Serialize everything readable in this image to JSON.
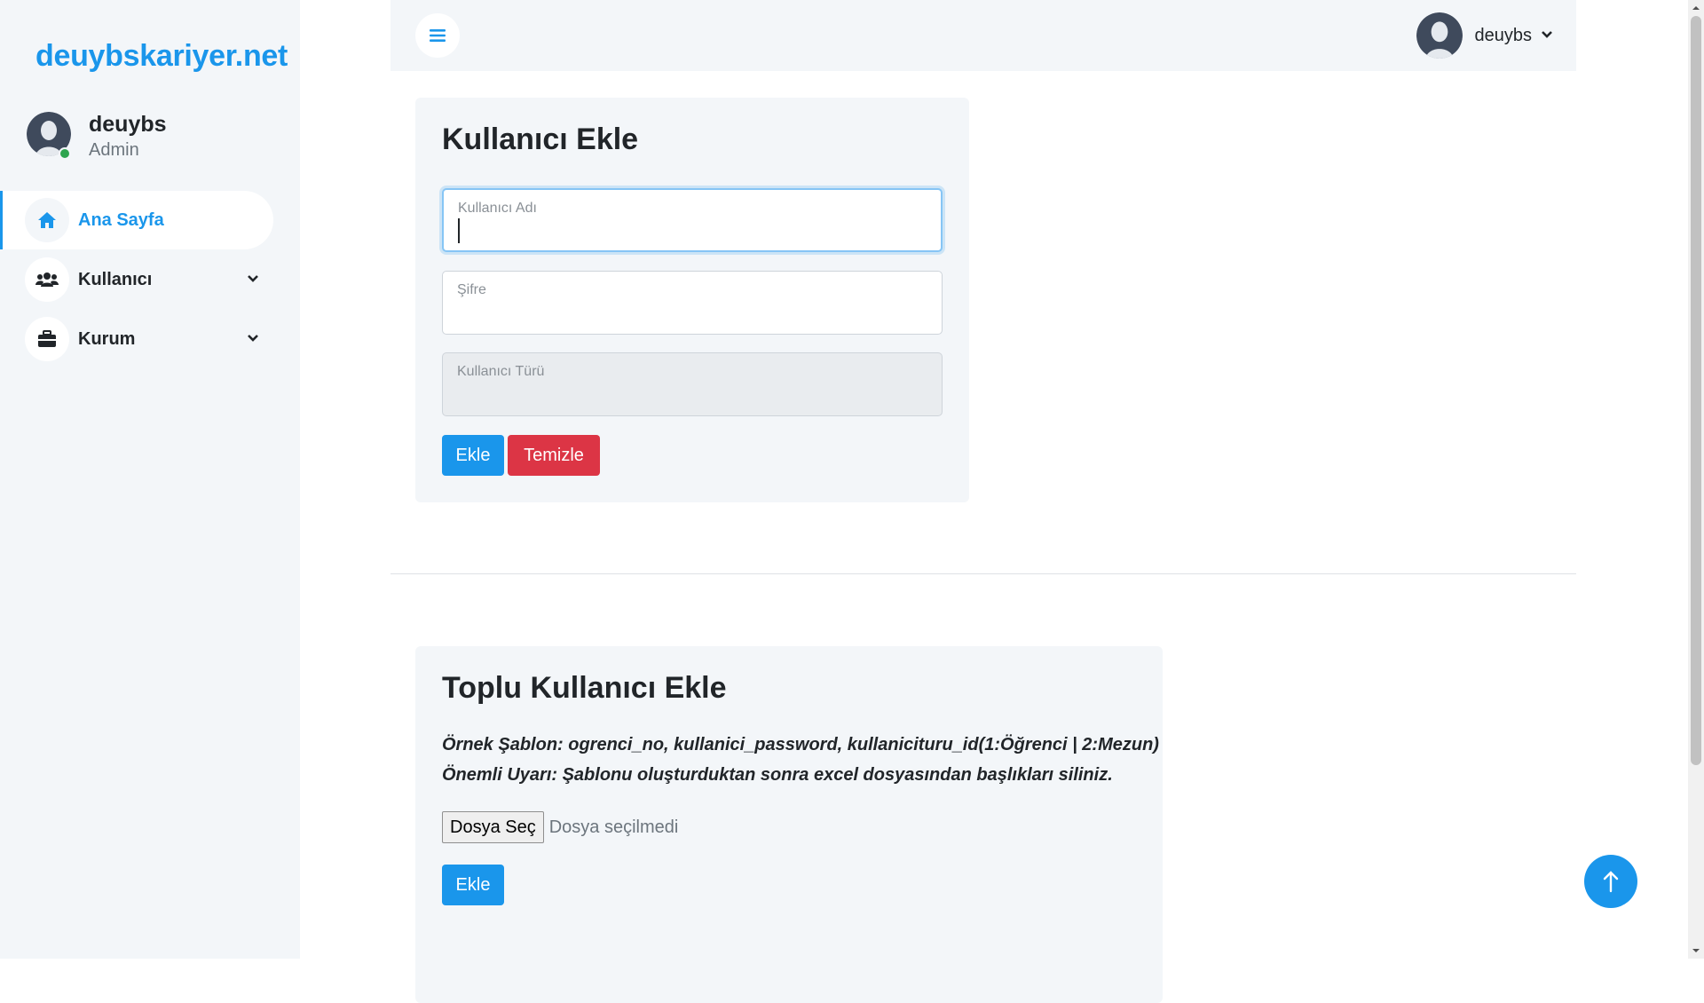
{
  "brand": {
    "name": "deuybskariyer.net"
  },
  "profile": {
    "name": "deuybs",
    "role": "Admin"
  },
  "sidebar": {
    "items": [
      {
        "label": "Ana Sayfa",
        "icon": "home-icon",
        "active": true
      },
      {
        "label": "Kullanıcı",
        "icon": "users-icon",
        "expandable": true
      },
      {
        "label": "Kurum",
        "icon": "briefcase-icon",
        "expandable": true
      }
    ]
  },
  "topbar": {
    "user_name": "deuybs"
  },
  "add_user": {
    "title": "Kullanıcı Ekle",
    "username_placeholder": "Kullanıcı Adı",
    "username_value": "",
    "password_placeholder": "Şifre",
    "password_value": "",
    "user_type_placeholder": "Kullanıcı Türü",
    "submit_label": "Ekle",
    "clear_label": "Temizle"
  },
  "bulk_add": {
    "title": "Toplu Kullanıcı Ekle",
    "template_note": "Örnek Şablon: ogrenci_no, kullanici_password, kullanicituru_id(1:Öğrenci | 2:Mezun)",
    "warning_note": "Önemli Uyarı: Şablonu oluşturduktan sonra excel dosyasından başlıkları siliniz.",
    "file_button_label": "Dosya Seç",
    "file_status": "Dosya seçilmedi",
    "submit_label": "Ekle"
  },
  "colors": {
    "accent": "#1a96eb",
    "danger": "#dc3545",
    "panel": "#f3f6f9",
    "online": "#2ea44f"
  }
}
